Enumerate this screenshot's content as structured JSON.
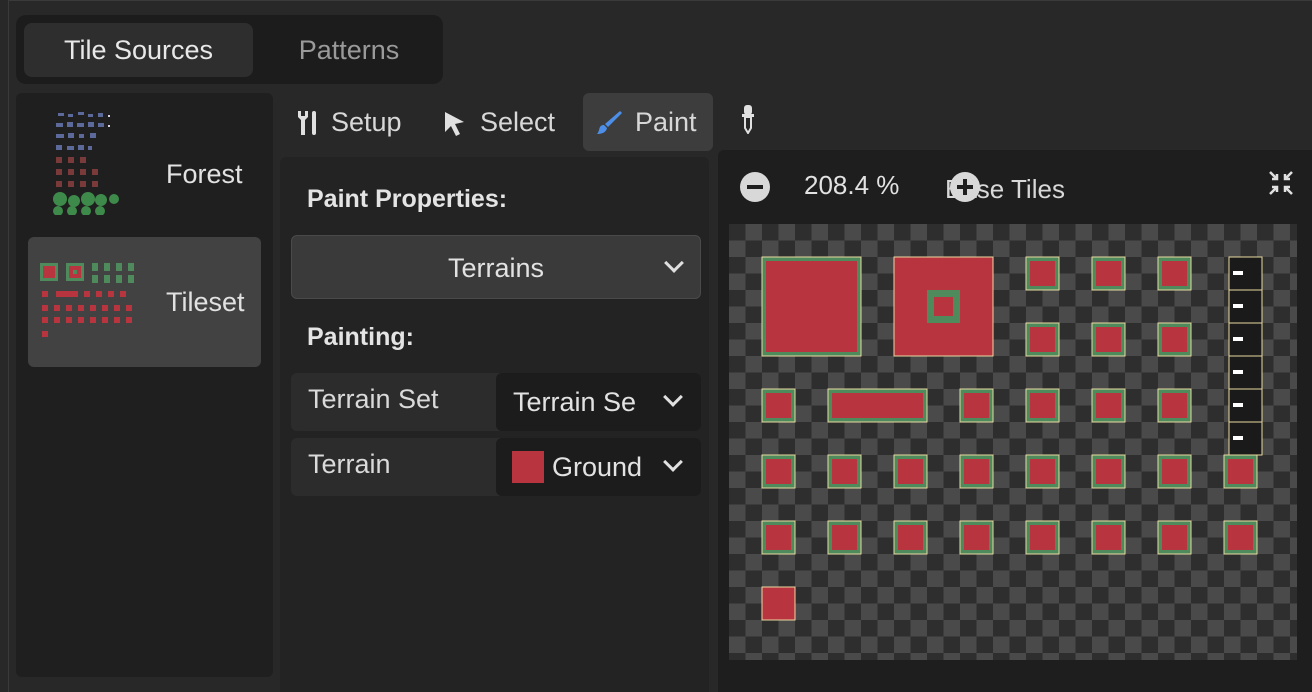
{
  "tabs": {
    "tile_sources": "Tile Sources",
    "patterns": "Patterns"
  },
  "sources": [
    {
      "label": "Forest",
      "selected": false
    },
    {
      "label": "Tileset",
      "selected": true
    }
  ],
  "toolbar": {
    "setup": "Setup",
    "select": "Select",
    "paint": "Paint",
    "picker_icon": "eyedropper-icon"
  },
  "props": {
    "paint_properties_title": "Paint Properties:",
    "mode_value": "Terrains",
    "painting_title": "Painting:",
    "terrain_set_label": "Terrain Set",
    "terrain_set_value": "Terrain Se",
    "terrain_label": "Terrain",
    "terrain_value": "Ground",
    "terrain_color": "#b8343f"
  },
  "atlas": {
    "zoom": "208.4 %",
    "base_tiles": "Base Tiles"
  },
  "colors": {
    "accent": "#4d8fe8",
    "terrain_red": "#b8343f",
    "terrain_green": "#4f8a5c",
    "tile_outline": "#e8d9a0"
  }
}
